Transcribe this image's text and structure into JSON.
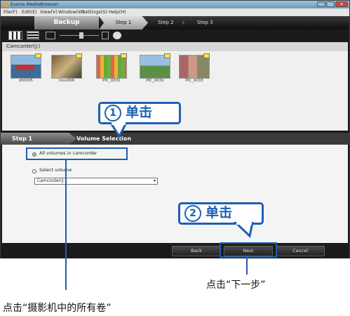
{
  "window": {
    "title": "Everio MediaBrowser",
    "min": "–",
    "max": "□",
    "close": "✕",
    "menu": [
      "File(F)",
      "Edit(E)",
      "View(V)",
      "Window(W)",
      "Settings(S)",
      "Help(H)"
    ]
  },
  "header": {
    "title": "Backup",
    "steps": [
      "Step 1",
      "Step 2",
      "Step 3"
    ]
  },
  "panel": {
    "title": "Camcorder(J:)",
    "thumbs": [
      "dt0005",
      "mov006",
      "PIC_0031",
      "PIC_0032",
      "PIC_0033"
    ]
  },
  "step_bar": {
    "step": "Step 1",
    "title": "Volume Selection"
  },
  "options": {
    "all_volumes": "All volumes in camcorder",
    "select_volume": "Select volume",
    "dropdown_value": "Camcorder(J:)"
  },
  "footer": {
    "back": "Back",
    "next": "Next",
    "cancel": "Cancel"
  },
  "annotations": {
    "callout1_num": "1",
    "callout1_text": "单击",
    "callout2_num": "2",
    "callout2_text": "单击",
    "note_next": "点击“下一步”",
    "note_all": "点击“摄影机中的所有卷”"
  },
  "colors": {
    "accent": "#1e5fb3"
  }
}
